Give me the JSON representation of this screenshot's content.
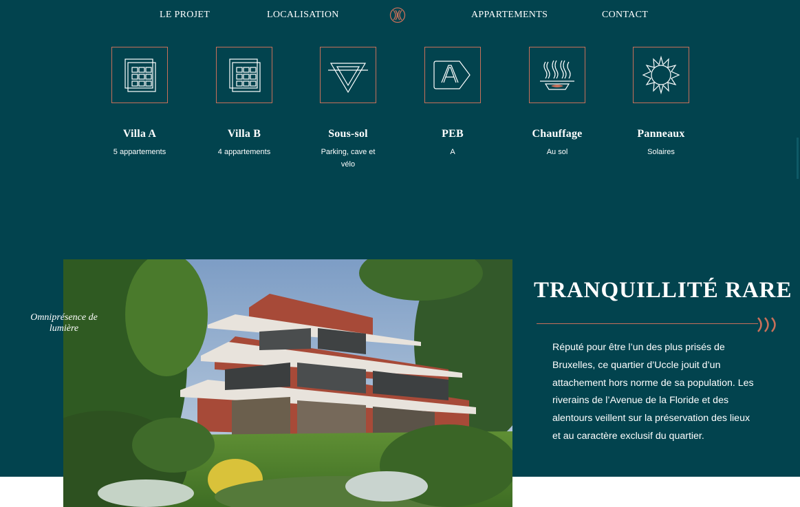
{
  "nav": {
    "items": [
      {
        "label": "LE PROJET"
      },
      {
        "label": "LOCALISATION"
      },
      {
        "label": "APPARTEMENTS"
      },
      {
        "label": "CONTACT"
      }
    ]
  },
  "colors": {
    "background": "#02434e",
    "accent": "#c9705a",
    "text": "#ffffff"
  },
  "features": [
    {
      "title": "Villa A",
      "sub": "5 appartements",
      "icon": "building-grid-icon"
    },
    {
      "title": "Villa B",
      "sub": "4 appartements",
      "icon": "building-grid-icon"
    },
    {
      "title": "Sous-sol",
      "sub": "Parking, cave et vélo",
      "icon": "triangle-down-icon"
    },
    {
      "title": "PEB",
      "sub": "A",
      "icon": "energy-label-icon"
    },
    {
      "title": "Chauffage",
      "sub": "Au sol",
      "icon": "floor-heating-icon"
    },
    {
      "title": "Panneaux",
      "sub": "Solaires",
      "icon": "sun-icon"
    }
  ],
  "section": {
    "caption": "Omniprésence de lumière",
    "heading": "TRANQUILLITÉ RARE",
    "paragraph": "Réputé pour être l’un des plus prisés de Bruxelles, ce quartier d’Uccle jouit d’un attachement hors norme de sa population. Les riverains de l’Avenue de la Floride et des alentours veillent sur la préservation des lieux et au caractère exclusif du quartier."
  }
}
